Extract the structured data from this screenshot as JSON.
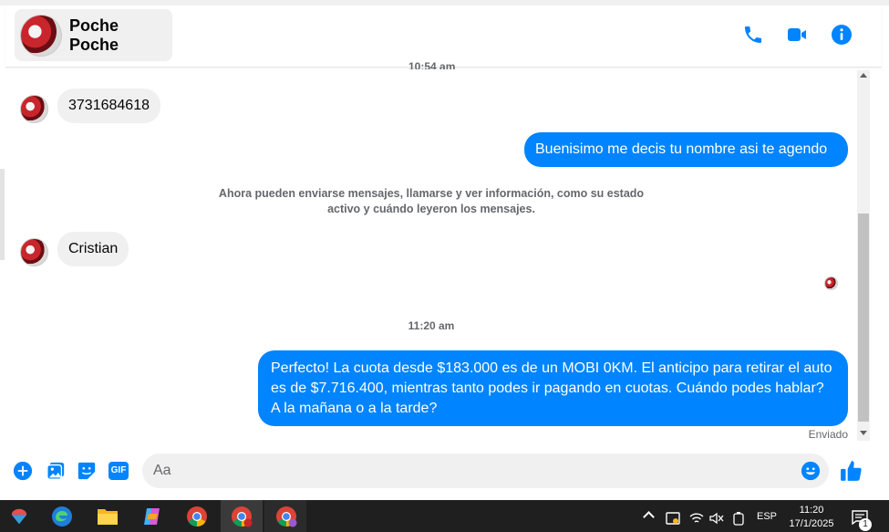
{
  "header": {
    "contact_name": "Poche Poche",
    "icons": [
      "phone-icon",
      "video-call-icon",
      "info-icon"
    ]
  },
  "colors": {
    "accent": "#0084ff",
    "incoming_bubble": "#f0f0f0",
    "text_secondary": "#65676b"
  },
  "conversation": {
    "cut_timestamp": "10:54 am",
    "messages": [
      {
        "direction": "incoming",
        "text": "3731684618"
      },
      {
        "direction": "outgoing",
        "text": "Buenisimo me decis tu nombre asi te agendo"
      },
      {
        "direction": "system",
        "text": "Ahora pueden enviarse mensajes, llamarse y ver información, como su estado activo y cuándo leyeron los mensajes."
      },
      {
        "direction": "incoming",
        "text": "Cristian"
      },
      {
        "direction": "timestamp",
        "text": "11:20 am"
      },
      {
        "direction": "outgoing",
        "text": "Perfecto! La cuota desde $183.000 es de un MOBI 0KM. El anticipo para retirar el auto es de $7.716.400, mientras tanto podes ir pagando en cuotas. Cuándo podes hablar? A la mañana o a la tarde?"
      }
    ],
    "status": "Enviado"
  },
  "composer": {
    "placeholder": "Aa",
    "icons": [
      "plus-icon",
      "image-icon",
      "sticker-icon",
      "gif-icon",
      "emoji-icon",
      "thumbs-up-icon"
    ],
    "gif_label": "GIF"
  },
  "taskbar": {
    "language": "ESP",
    "time": "11:20",
    "date": "17/1/2025",
    "notification_count": "1"
  }
}
